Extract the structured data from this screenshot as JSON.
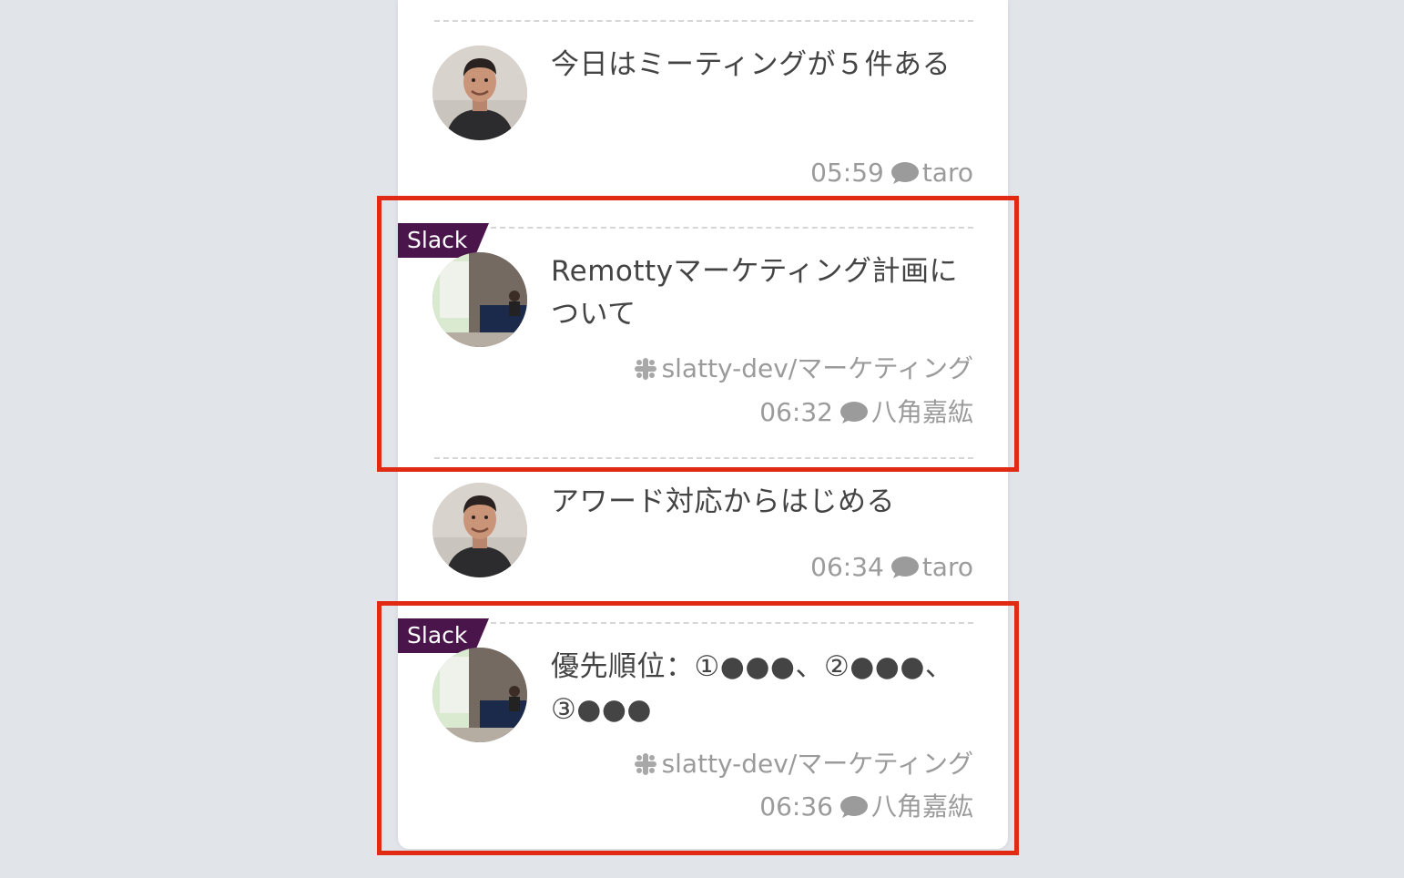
{
  "messages": [
    {
      "text": "今日はミーティングが５件ある",
      "time": "05:59",
      "author": "taro",
      "avatar_icon": "user-avatar-man"
    },
    {
      "tag": "Slack",
      "text": "Remottyマーケティング計画について",
      "channel": "slatty-dev/マーケティング",
      "time": "06:32",
      "author": "八角嘉紘",
      "avatar_icon": "user-avatar-conference"
    },
    {
      "text": "アワード対応からはじめる",
      "time": "06:34",
      "author": "taro",
      "avatar_icon": "user-avatar-man"
    },
    {
      "tag": "Slack",
      "text": "優先順位：①●●●、②●●●、③●●●",
      "channel": "slatty-dev/マーケティング",
      "time": "06:36",
      "author": "八角嘉紘",
      "avatar_icon": "user-avatar-conference"
    }
  ],
  "colors": {
    "background": "#e1e4e9",
    "card": "#ffffff",
    "slack_tag": "#4a154b",
    "highlight": "#e02a13",
    "text": "#444444",
    "meta": "#9b9b9b"
  }
}
